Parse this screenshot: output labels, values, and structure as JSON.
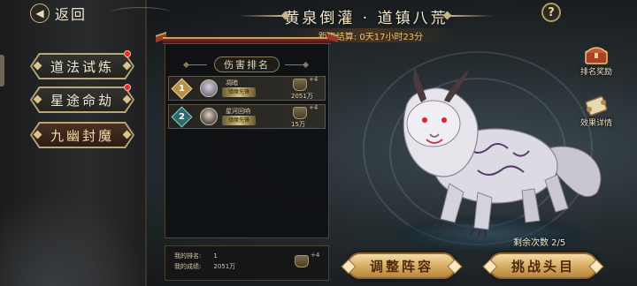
{
  "nav": {
    "back_label": "返回"
  },
  "menu": {
    "items": [
      {
        "label": "道法试炼",
        "active": false,
        "notify": true
      },
      {
        "label": "星途命劫",
        "active": false,
        "notify": true
      },
      {
        "label": "九幽封魔",
        "active": true,
        "notify": false
      }
    ]
  },
  "header": {
    "title": "黄泉倒灌 · 道镇八荒",
    "countdown": "距离结算: 0天17小时23分",
    "help_glyph": "?"
  },
  "ranking": {
    "tab_label": "伤害排名",
    "rows": [
      {
        "rank": "1",
        "name": "凋暗",
        "title": "镇魔先锋",
        "damage": "2051万",
        "bonus": "+4"
      },
      {
        "rank": "2",
        "name": "星河回响",
        "title": "镇魔先锋",
        "damage": "15万",
        "bonus": "+4"
      }
    ],
    "my_rank_label": "我的排名:",
    "my_rank_value": "1",
    "my_score_label": "我的成绩:",
    "my_score_value": "2051万",
    "my_bonus": "+4"
  },
  "side_buttons": {
    "rank_reward": "排名奖励",
    "effect_detail": "效果详情"
  },
  "boss": {
    "remaining": "剩余次数  2/5"
  },
  "actions": {
    "adjust": "调整阵容",
    "challenge": "挑战头目"
  },
  "colors": {
    "accent_gold": "#d6aa5e",
    "countdown": "#f0c070",
    "notify_red": "#e0302a"
  }
}
